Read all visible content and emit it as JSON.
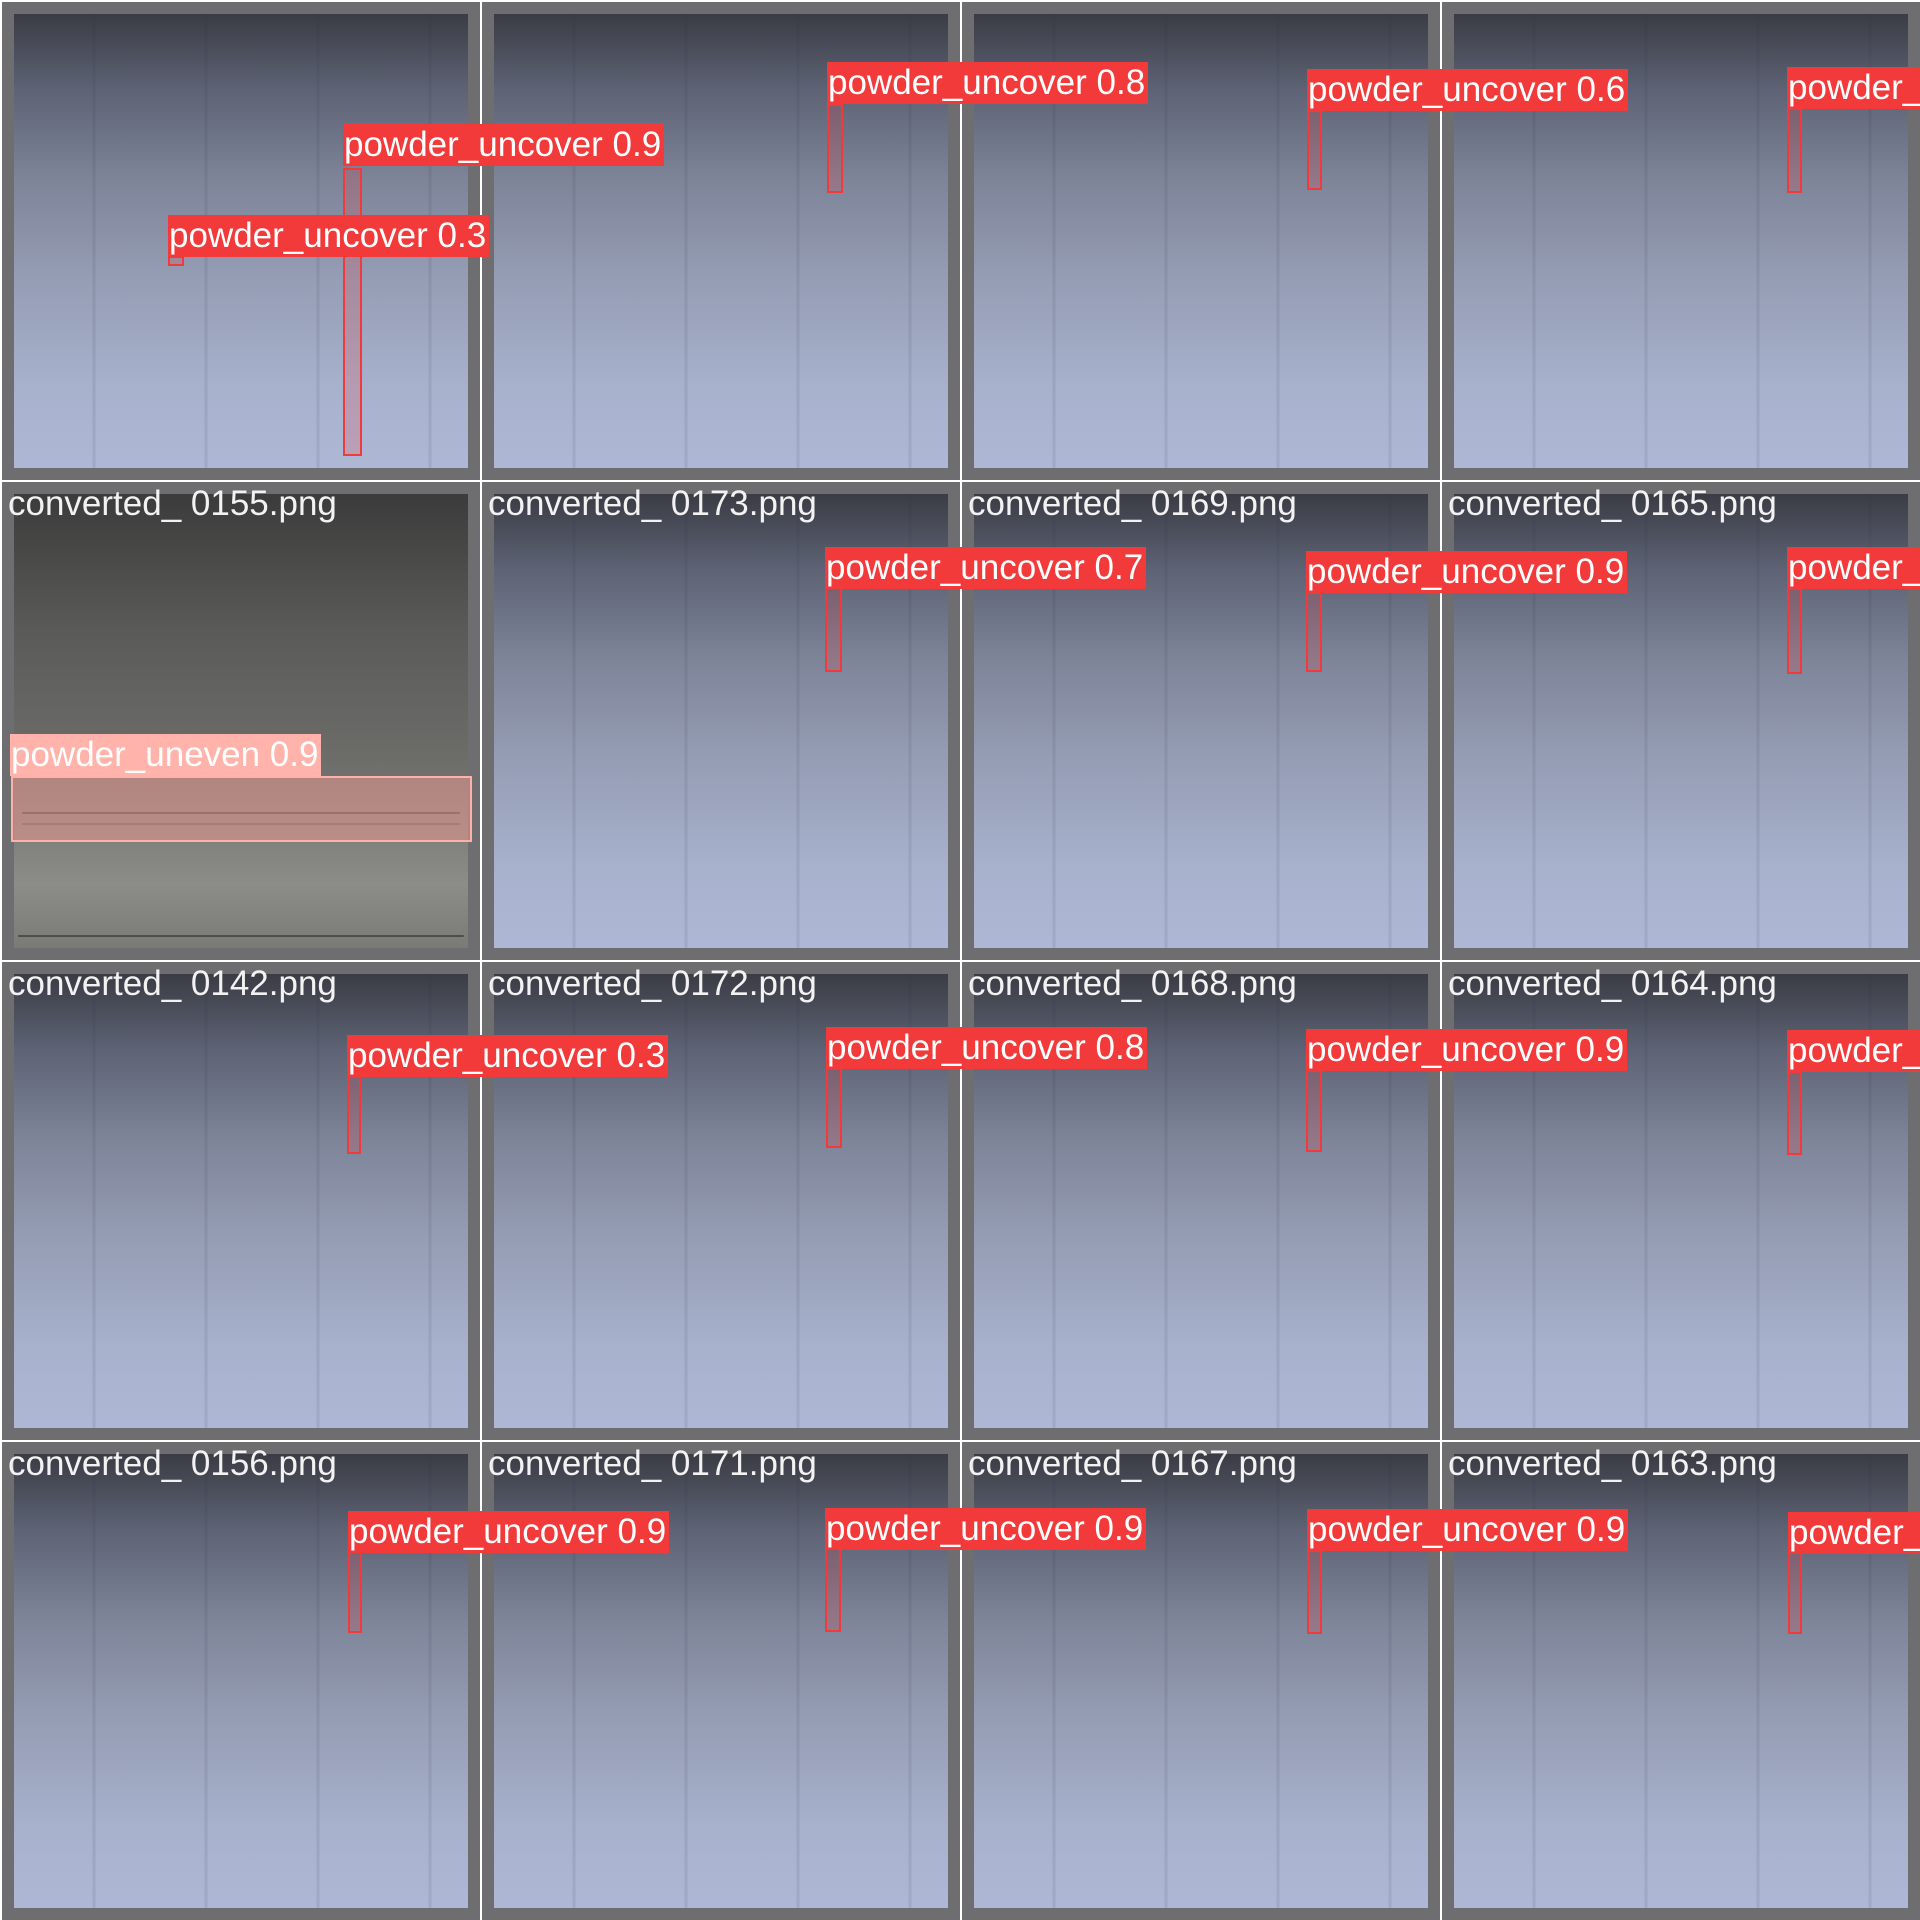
{
  "colors": {
    "uncover": "#f23a3a",
    "uneven": "#ffb3aa",
    "cell_frame": "#6e6e70",
    "filename_text": "#f2f2f2"
  },
  "cells": [
    {
      "filename": "",
      "detections": [
        {
          "label": "powder_uncover 0.9"
        },
        {
          "label": "powder_uncover 0.3"
        }
      ]
    },
    {
      "filename": "",
      "detections": [
        {
          "label": "powder_uncover 0.8"
        }
      ]
    },
    {
      "filename": "",
      "detections": [
        {
          "label": "powder_uncover 0.6"
        }
      ]
    },
    {
      "filename": "",
      "detections": [
        {
          "label": "powder_"
        }
      ]
    },
    {
      "filename": "converted_ 0155.png",
      "detections": [
        {
          "label": "powder_uneven 0.9"
        }
      ]
    },
    {
      "filename": "converted_ 0173.png",
      "detections": [
        {
          "label": "powder_uncover 0.7"
        }
      ]
    },
    {
      "filename": "converted_ 0169.png",
      "detections": [
        {
          "label": "powder_uncover 0.9"
        }
      ]
    },
    {
      "filename": "converted_ 0165.png",
      "detections": [
        {
          "label": "powder_"
        }
      ]
    },
    {
      "filename": "converted_ 0142.png",
      "detections": [
        {
          "label": "powder_uncover 0.3"
        }
      ]
    },
    {
      "filename": "converted_ 0172.png",
      "detections": [
        {
          "label": "powder_uncover 0.8"
        }
      ]
    },
    {
      "filename": "converted_ 0168.png",
      "detections": [
        {
          "label": "powder_uncover 0.9"
        }
      ]
    },
    {
      "filename": "converted_ 0164.png",
      "detections": [
        {
          "label": "powder_"
        }
      ]
    },
    {
      "filename": "converted_ 0156.png",
      "detections": [
        {
          "label": "powder_uncover 0.9"
        }
      ]
    },
    {
      "filename": "converted_ 0171.png",
      "detections": [
        {
          "label": "powder_uncover 0.9"
        }
      ]
    },
    {
      "filename": "converted_ 0167.png",
      "detections": [
        {
          "label": "powder_uncover 0.9"
        }
      ]
    },
    {
      "filename": "converted_ 0163.png",
      "detections": [
        {
          "label": "powder_"
        }
      ]
    }
  ]
}
